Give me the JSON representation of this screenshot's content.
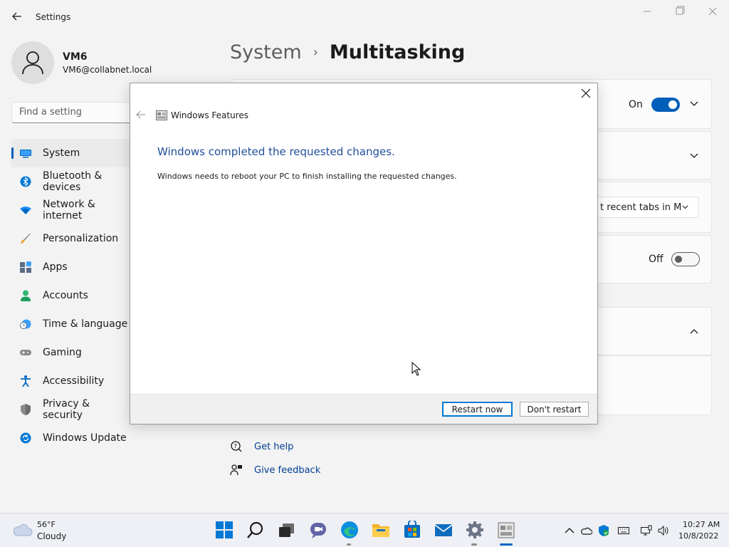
{
  "window": {
    "title": "Settings"
  },
  "profile": {
    "name": "VM6",
    "email": "VM6@collabnet.local"
  },
  "search": {
    "placeholder": "Find a setting"
  },
  "sidebar": {
    "items": [
      {
        "label": "System",
        "icon": "system-monitor-icon",
        "active": true
      },
      {
        "label": "Bluetooth & devices",
        "icon": "bluetooth-icon"
      },
      {
        "label": "Network & internet",
        "icon": "wifi-icon"
      },
      {
        "label": "Personalization",
        "icon": "brush-icon"
      },
      {
        "label": "Apps",
        "icon": "apps-icon"
      },
      {
        "label": "Accounts",
        "icon": "person-icon"
      },
      {
        "label": "Time & language",
        "icon": "clock-globe-icon"
      },
      {
        "label": "Gaming",
        "icon": "gamepad-icon"
      },
      {
        "label": "Accessibility",
        "icon": "accessibility-icon"
      },
      {
        "label": "Privacy & security",
        "icon": "shield-icon"
      },
      {
        "label": "Windows Update",
        "icon": "update-icon"
      }
    ]
  },
  "breadcrumb": {
    "parent": "System",
    "separator": "›",
    "current": "Multitasking"
  },
  "settings": {
    "snap_toggle_label": "On",
    "alt_tab_dropdown_value": "t recent tabs in M",
    "desktops_toggle_label": "Off"
  },
  "help": {
    "get_help": "Get help",
    "give_feedback": "Give feedback"
  },
  "dialog": {
    "title": "Windows Features",
    "heading": "Windows completed the requested changes.",
    "message": "Windows needs to reboot your PC to finish installing the requested changes.",
    "restart_label": "Restart now",
    "dont_restart_label": "Don't restart"
  },
  "taskbar": {
    "weather_temp": "56°F",
    "weather_condition": "Cloudy",
    "apps": [
      "start-icon",
      "search-icon",
      "task-view-icon",
      "chat-icon",
      "edge-icon",
      "file-explorer-icon",
      "store-icon",
      "mail-icon",
      "settings-icon",
      "windows-features-icon"
    ],
    "time": "10:27 AM",
    "date": "10/8/2022"
  },
  "colors": {
    "accent": "#005fb8",
    "dialog_heading": "#1f4e9a",
    "link": "#003e92"
  }
}
